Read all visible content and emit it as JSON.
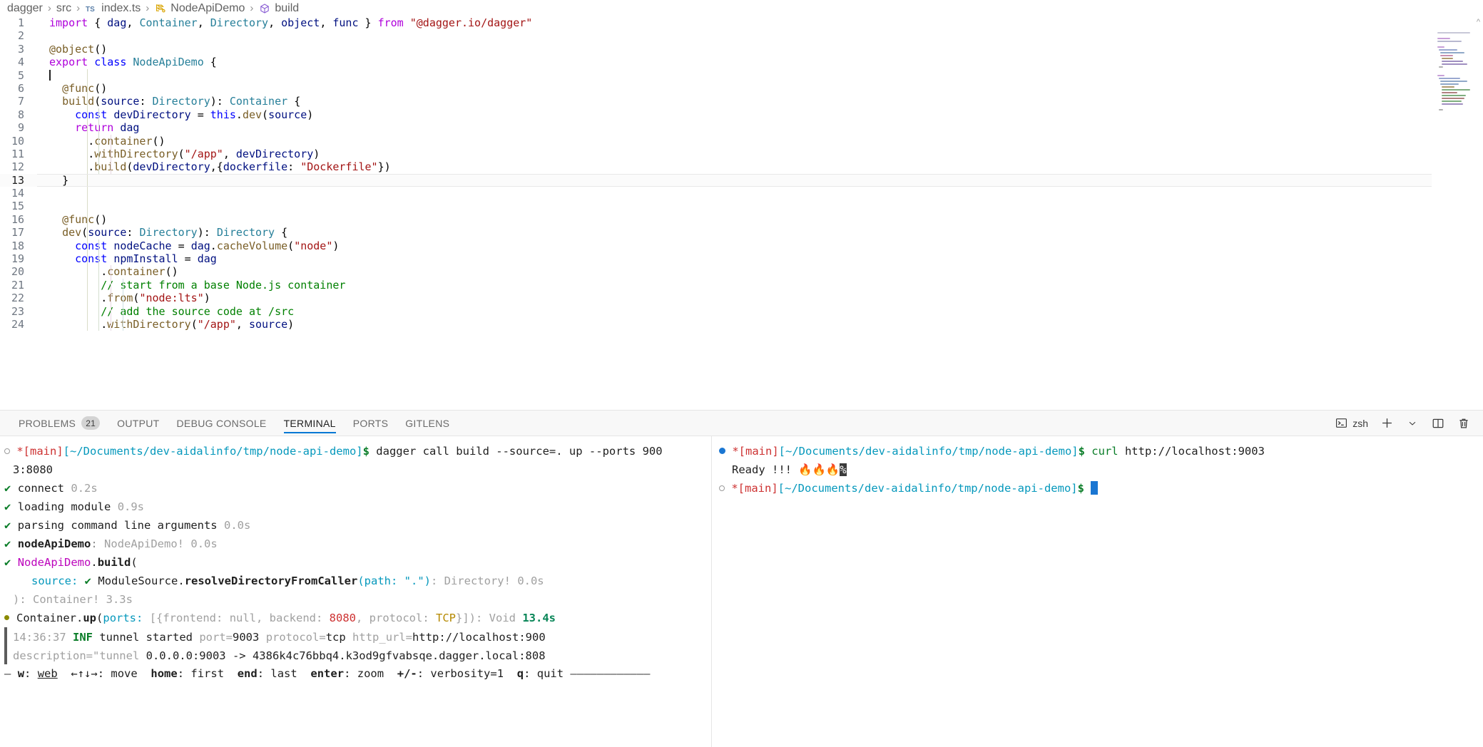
{
  "breadcrumb": {
    "items": [
      {
        "label": "dagger",
        "icon": null
      },
      {
        "label": "src",
        "icon": null
      },
      {
        "label": "index.ts",
        "icon": "typescript-file-icon"
      },
      {
        "label": "NodeApiDemo",
        "icon": "class-symbol-icon"
      },
      {
        "label": "build",
        "icon": "method-symbol-icon"
      }
    ],
    "separator": "›"
  },
  "editor": {
    "current_line": 13,
    "lightbulb_line": 12,
    "lines": [
      {
        "n": 1,
        "text": "import { dag, Container, Directory, object, func } from \"@dagger.io/dagger\""
      },
      {
        "n": 2,
        "text": ""
      },
      {
        "n": 3,
        "text": "@object()"
      },
      {
        "n": 4,
        "text": "export class NodeApiDemo {"
      },
      {
        "n": 5,
        "text": ""
      },
      {
        "n": 6,
        "text": "  @func()"
      },
      {
        "n": 7,
        "text": "  build(source: Directory): Container {"
      },
      {
        "n": 8,
        "text": "    const devDirectory = this.dev(source)"
      },
      {
        "n": 9,
        "text": "    return dag"
      },
      {
        "n": 10,
        "text": "      .container()"
      },
      {
        "n": 11,
        "text": "      .withDirectory(\"/app\", devDirectory)"
      },
      {
        "n": 12,
        "text": "      .build(devDirectory,{dockerfile: \"Dockerfile\"})"
      },
      {
        "n": 13,
        "text": "  }"
      },
      {
        "n": 14,
        "text": ""
      },
      {
        "n": 15,
        "text": ""
      },
      {
        "n": 16,
        "text": "  @func()"
      },
      {
        "n": 17,
        "text": "  dev(source: Directory): Directory {"
      },
      {
        "n": 18,
        "text": "    const nodeCache = dag.cacheVolume(\"node\")"
      },
      {
        "n": 19,
        "text": "    const npmInstall = dag"
      },
      {
        "n": 20,
        "text": "        .container()"
      },
      {
        "n": 21,
        "text": "        // start from a base Node.js container"
      },
      {
        "n": 22,
        "text": "        .from(\"node:lts\")"
      },
      {
        "n": 23,
        "text": "        // add the source code at /src"
      },
      {
        "n": 24,
        "text": "        .withDirectory(\"/app\", source)"
      }
    ]
  },
  "panel": {
    "tabs": [
      {
        "label": "PROBLEMS",
        "badge": "21",
        "active": false
      },
      {
        "label": "OUTPUT",
        "badge": null,
        "active": false
      },
      {
        "label": "DEBUG CONSOLE",
        "badge": null,
        "active": false
      },
      {
        "label": "TERMINAL",
        "badge": null,
        "active": true
      },
      {
        "label": "PORTS",
        "badge": null,
        "active": false
      },
      {
        "label": "GITLENS",
        "badge": null,
        "active": false
      }
    ],
    "actions": {
      "shell_label": "zsh",
      "shell_icon": "terminal-icon",
      "new_terminal_icon": "plus-icon",
      "dropdown_icon": "chevron-down-icon",
      "split_icon": "split-editor-icon",
      "kill_icon": "trash-icon"
    }
  },
  "terminal": {
    "left": {
      "prompt_branch": "*[main]",
      "prompt_path": "[~/Documents/dev-aidalinfo/tmp/node-api-demo]",
      "prompt_sigil": "$",
      "command": "dagger call build --source=. up --ports 900",
      "command_wrap": "3:8080",
      "lines": [
        {
          "check": "✔",
          "label": "connect",
          "time": "0.2s"
        },
        {
          "check": "✔",
          "label": "loading module",
          "time": "0.9s"
        },
        {
          "check": "✔",
          "label": "parsing command line arguments",
          "time": "0.0s"
        }
      ],
      "node_line": {
        "check": "✔",
        "name": "nodeApiDemo",
        "colon": ":",
        "type": "NodeApiDemo!",
        "time": "0.0s"
      },
      "build_line": {
        "check": "✔",
        "obj": "NodeApiDemo",
        "dot": ".",
        "method": "build",
        "paren": "("
      },
      "source_line": {
        "arg": "source:",
        "check": "✔",
        "obj": "ModuleSource",
        "dot": ".",
        "method": "resolveDirectoryFromCaller",
        "params": "(path: \".\")",
        "ret": ": Directory!",
        "time": "0.0s"
      },
      "close_line": "): Container! 3.3s",
      "up_line": {
        "obj": "Container",
        "dot": ".",
        "method": "up",
        "open": "(",
        "ports_key": "ports:",
        "bracket": " [{frontend: ",
        "nullv": "null",
        "backend_key": ", backend: ",
        "backend_val": "8080",
        "proto_key": ", protocol: ",
        "proto_val": "TCP",
        "close": "}]): ",
        "ret": "Void",
        "time": "13.4s"
      },
      "tunnel_line": {
        "ts": "14:36:37",
        "level": "INF",
        "msg": "tunnel started",
        "port_key": "port=",
        "port_val": "9003",
        "proto_key": "protocol=",
        "proto_val": "tcp",
        "url_key": "http_url=",
        "url_val": "http://localhost:900"
      },
      "desc_line": {
        "key": "description=",
        "text": "\"tunnel ",
        "mapping": "0.0.0.0:9003 -> 4386k4c76bbq4.k3od9gfvabsqe.dagger.local:808"
      },
      "statusbar": {
        "dash_left": "—",
        "items": [
          {
            "key": "w",
            "val": "web"
          },
          {
            "key": "←↑↓→",
            "val": "move"
          },
          {
            "key": "home",
            "val": "first"
          },
          {
            "key": "end",
            "val": "last"
          },
          {
            "key": "enter",
            "val": "zoom"
          },
          {
            "key": "+/-",
            "val": "verbosity=1"
          },
          {
            "key": "q",
            "val": "quit"
          }
        ],
        "dash_right": "————————————"
      }
    },
    "right": {
      "prompt1_branch": "*[main]",
      "prompt1_path": "[~/Documents/dev-aidalinfo/tmp/node-api-demo]",
      "prompt1_sigil": "$",
      "command1": "curl",
      "command1_arg": " http://localhost:9003",
      "output_text": "Ready !!! ",
      "output_emoji": "🔥🔥🔥",
      "output_pct": "%",
      "prompt2_branch": "*[main]",
      "prompt2_path": "[~/Documents/dev-aidalinfo/tmp/node-api-demo]",
      "prompt2_sigil": "$"
    }
  },
  "colors": {
    "accent": "#0078d4",
    "success": "#0a7d28",
    "error": "#cd3131",
    "warning": "#b58900",
    "panel_bg": "#f8f8f8",
    "editor_bg": "#ffffff"
  }
}
